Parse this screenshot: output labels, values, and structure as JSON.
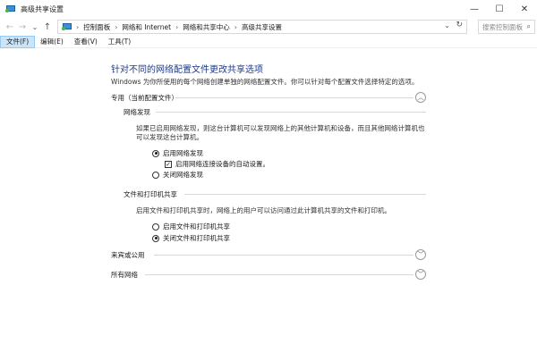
{
  "window": {
    "title": "高级共享设置",
    "controls": {
      "minimize": "—",
      "maximize": "☐",
      "close": "✕"
    }
  },
  "address": {
    "back": "←",
    "forward": "→",
    "recent": "⌄",
    "up": "↑",
    "breadcrumbs": [
      "控制面板",
      "网络和 Internet",
      "网络和共享中心",
      "高级共享设置"
    ],
    "separator": "›",
    "dropdown": "⌄",
    "refresh": "↻",
    "search_placeholder": "搜索控制面板",
    "search_icon": "⌕"
  },
  "menu": {
    "items": [
      "文件(F)",
      "编辑(E)",
      "查看(V)",
      "工具(T)"
    ],
    "active_index": 0
  },
  "main": {
    "heading": "针对不同的网络配置文件更改共享选项",
    "description": "Windows 为你所使用的每个网络创建单独的网络配置文件。你可以针对每个配置文件选择特定的选项。",
    "private_profile": {
      "label": "专用（当前配置文件）",
      "expanded": true,
      "chevron": "︿",
      "network_discovery": {
        "title": "网络发现",
        "text": "如果已启用网络发现，则这台计算机可以发现网络上的其他计算机和设备，而且其他网络计算机也可以发现这台计算机。",
        "opt_on": "启用网络发现",
        "opt_auto": "启用网络连接设备的自动设置。",
        "opt_off": "关闭网络发现",
        "selected": "on",
        "auto_checked": true,
        "check_mark": "✓"
      },
      "file_printer_sharing": {
        "title": "文件和打印机共享",
        "text": "启用文件和打印机共享时，网络上的用户可以访问通过此计算机共享的文件和打印机。",
        "opt_on": "启用文件和打印机共享",
        "opt_off": "关闭文件和打印机共享",
        "selected": "off"
      }
    },
    "guest_profile": {
      "label": "来宾或公用",
      "expanded": false,
      "chevron": "﹀"
    },
    "all_networks": {
      "label": "所有网络",
      "expanded": false,
      "chevron": "﹀"
    }
  },
  "colors": {
    "heading": "#1e3a8a",
    "menu_active_bg": "#cce4f7",
    "accent": "#3a8fd8"
  }
}
